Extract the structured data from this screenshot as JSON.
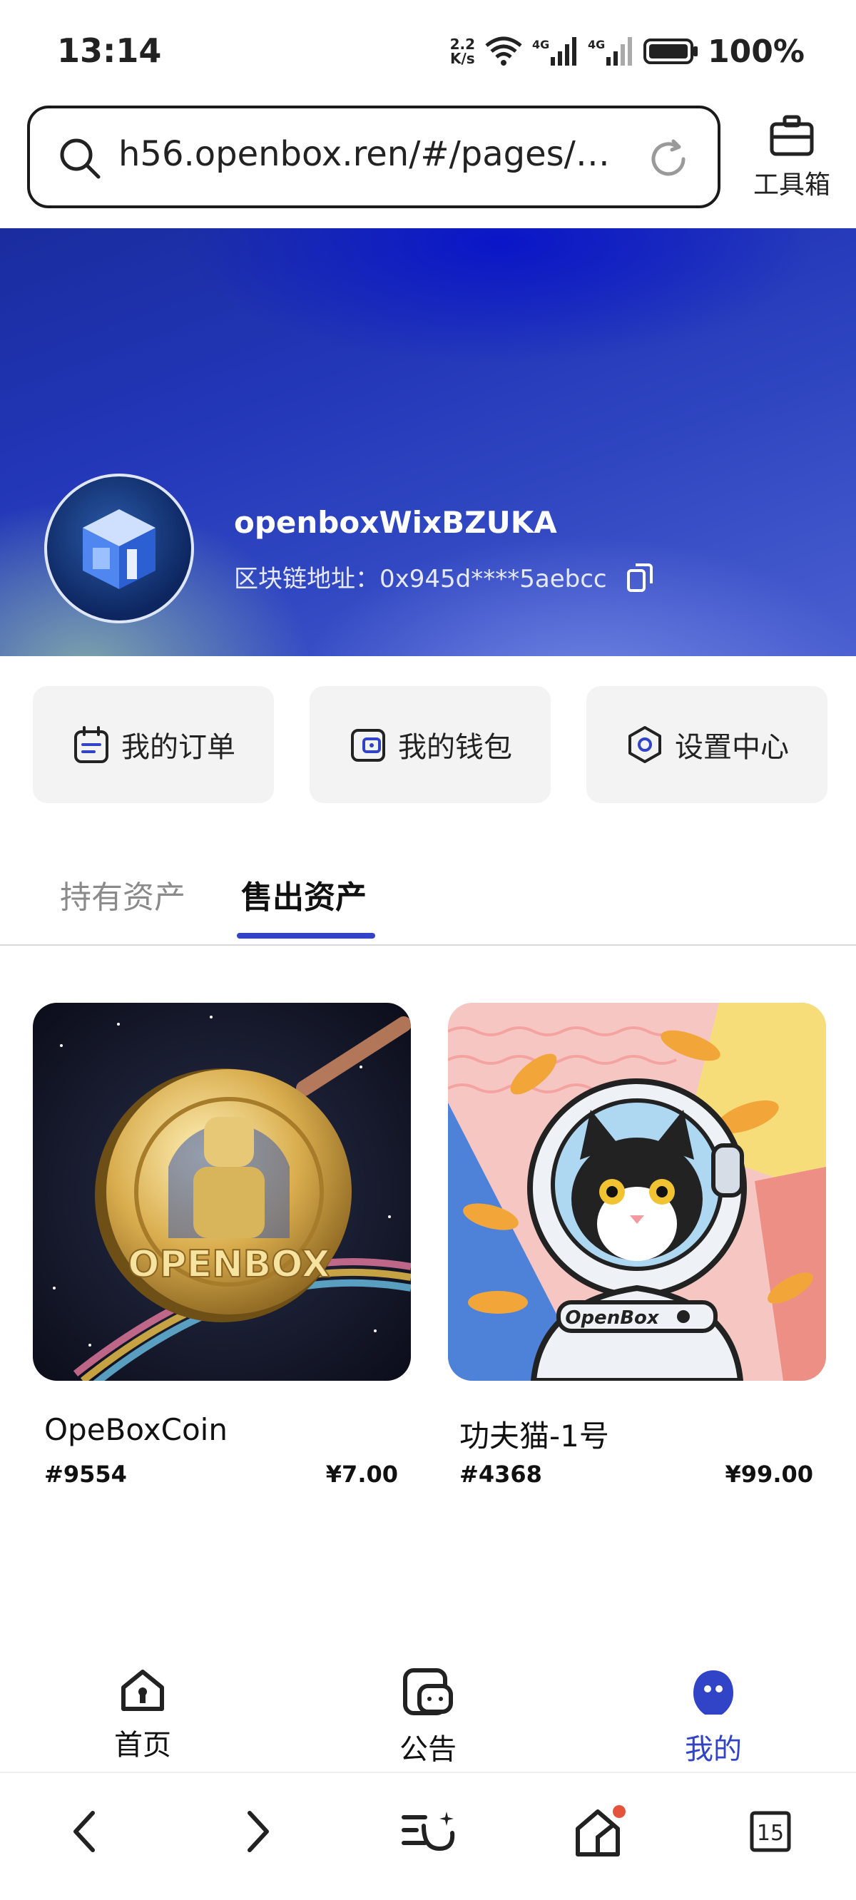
{
  "status_bar": {
    "time": "13:14",
    "net_speed_value": "2.2",
    "net_speed_unit": "K/s",
    "signal_1": "4G",
    "signal_2": "4G",
    "battery": "100%"
  },
  "browser": {
    "url": "h56.openbox.ren/#/pages/my...",
    "toolbox_label": "工具箱"
  },
  "profile": {
    "username": "openboxWixBZUKA",
    "chain_label": "区块链地址：",
    "chain_address": "0x945d****5aebcc"
  },
  "actions": [
    {
      "label": "我的订单",
      "icon": "calendar-icon"
    },
    {
      "label": "我的钱包",
      "icon": "wallet-icon"
    },
    {
      "label": "设置中心",
      "icon": "settings-icon"
    }
  ],
  "tabs": [
    {
      "label": "持有资产",
      "active": false
    },
    {
      "label": "售出资产",
      "active": true
    }
  ],
  "products": [
    {
      "name": "OpeBoxCoin",
      "id": "#9554",
      "price": "¥7.00",
      "image_text": "OPENBOX"
    },
    {
      "name": "功夫猫-1号",
      "id": "#4368",
      "price": "¥99.00",
      "image_text": "OpenBox"
    }
  ],
  "bottom_nav": [
    {
      "label": "首页",
      "icon": "home-icon",
      "active": false
    },
    {
      "label": "公告",
      "icon": "announcement-icon",
      "active": false
    },
    {
      "label": "我的",
      "icon": "profile-icon",
      "active": true
    }
  ],
  "system_nav": {
    "tab_count": "15"
  },
  "colors": {
    "accent": "#3144c8",
    "notification_dot": "#e5533d"
  }
}
